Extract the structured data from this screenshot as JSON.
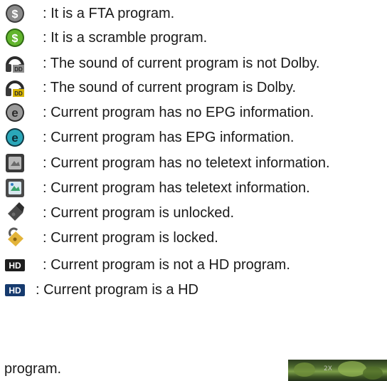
{
  "legend": [
    {
      "icon": "fta-dollar-gray-icon",
      "text": ": It is a FTA program."
    },
    {
      "icon": "scramble-dollar-green-icon",
      "text": ": It is a scramble program."
    },
    {
      "icon": "dolby-off-headphone-icon",
      "text": ": The sound of current program is not Dolby."
    },
    {
      "icon": "dolby-on-headphone-icon",
      "text": ": The sound of current program is Dolby."
    },
    {
      "icon": "epg-off-icon",
      "text": ": Current program has no EPG information."
    },
    {
      "icon": "epg-on-icon",
      "text": ": Current program has EPG information."
    },
    {
      "icon": "teletext-off-icon",
      "text": ": Current program has no teletext information."
    },
    {
      "icon": "teletext-on-icon",
      "text": ": Current program has teletext information."
    },
    {
      "icon": "unlocked-icon",
      "text": ": Current program is unlocked."
    },
    {
      "icon": "locked-icon",
      "text": ": Current program is locked."
    },
    {
      "icon": "hd-off-icon",
      "text": ": Current program is not a HD program."
    },
    {
      "icon": "hd-on-icon",
      "text": ": Current program is a HD"
    }
  ],
  "wrap_text": "program.",
  "thumbnail_label": "2X",
  "colors": {
    "gray_icon": "#7a7a7a",
    "green_icon": "#5fae2a",
    "dolby_gold": "#d4b200",
    "epg_teal": "#1f9fb0",
    "lock_gold": "#e3b43a",
    "hd_blue": "#2a6fd0"
  }
}
